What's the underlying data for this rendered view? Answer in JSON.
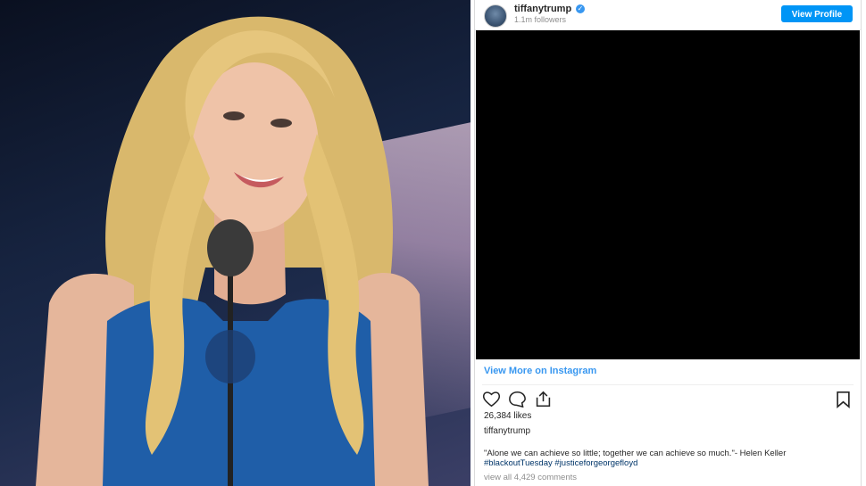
{
  "post": {
    "username": "tiffanytrump",
    "verified_mark": "✓",
    "followers": "1.1m followers",
    "view_profile_label": "View Profile",
    "view_more_label": "View More on Instagram",
    "likes": "26,384 likes",
    "caption_owner": "tiffanytrump",
    "caption_text": "\"Alone we can achieve so little; together we can achieve so much.\"- Helen Keller",
    "hashtags": [
      "#blackoutTuesday",
      "#justiceforgeorgefloyd"
    ],
    "comments_link": "view all 4,429 comments",
    "media_color": "#000000"
  },
  "icons": [
    "avatar",
    "verified-icon",
    "heart-icon",
    "comment-icon",
    "share-icon",
    "bookmark-icon"
  ],
  "colors": {
    "accent": "#0095f6",
    "link": "#3897f0",
    "hashtag": "#003569"
  }
}
